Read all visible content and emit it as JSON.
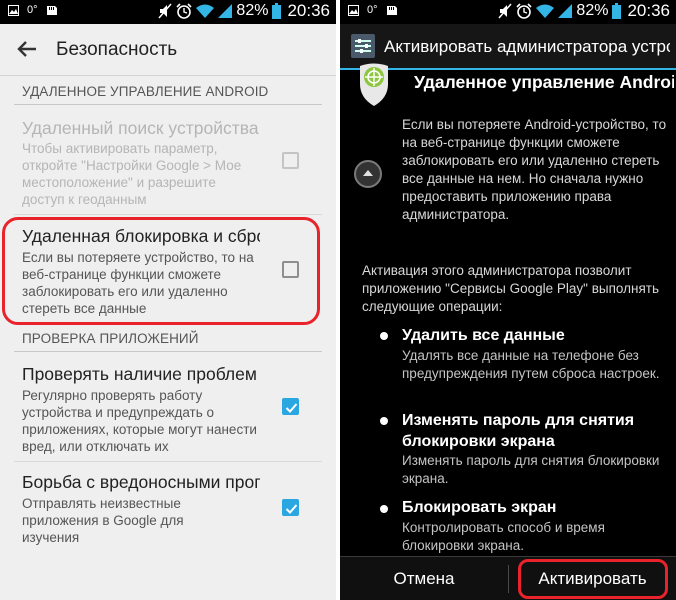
{
  "status_bar": {
    "left_label": "0°",
    "battery_pct": "82%",
    "time": "20:36"
  },
  "security_screen": {
    "title": "Безопасность",
    "section_android": "УДАЛЕННОЕ УПРАВЛЕНИЕ ANDROID",
    "remote_find": {
      "title": "Удаленный поиск устройства",
      "summary": "Чтобы активировать параметр, откройте \"Настройки Google > Мое местоположение\" и разрешите доступ к геоданным",
      "checked": false,
      "enabled": false
    },
    "remote_lock": {
      "title": "Удаленная блокировка и сброс",
      "summary": "Если вы потеряете устройство, то на веб-странице функции сможете заблокировать его или удаленно стереть все данные",
      "checked": false,
      "enabled": true
    },
    "section_apps": "ПРОВЕРКА ПРИЛОЖЕНИЙ",
    "verify_apps": {
      "title": "Проверять наличие проблем",
      "summary": "Регулярно проверять работу устройства и предупреждать о приложениях, которые могут нанести вред, или отключать их",
      "checked": true
    },
    "malware": {
      "title": "Борьба с вредоносными программами",
      "summary": "Отправлять неизвестные приложения в Google для изучения",
      "checked": true
    }
  },
  "admin_screen": {
    "title": "Активировать администратора устройства?",
    "app_name": "Удаленное управление Android",
    "description": "Если вы потеряете Android-устройство, то на веб-странице функции сможете заблокировать его или удаленно стереть все данные на нем. Но сначала нужно предоставить приложению права администратора.",
    "intro": "Активация этого администратора позволит приложению \"Сервисы Google Play\" выполнять следующие операции:",
    "policies": [
      {
        "title": "Удалить все данные",
        "desc": "Удалять все данные на телефоне без предупреждения путем сброса настроек."
      },
      {
        "title": "Изменять пароль для снятия блокировки экрана",
        "desc": "Изменять пароль для снятия блокировки экрана."
      },
      {
        "title": "Блокировать экран",
        "desc": "Контролировать способ и время блокировки экрана."
      }
    ],
    "cancel_label": "Отмена",
    "activate_label": "Активировать"
  },
  "colors": {
    "accent_blue": "#33b5e5",
    "checkbox_blue": "#2aa6e0",
    "highlight_red": "#e8232b",
    "dark_bg": "#000000",
    "light_bg": "#efefef"
  },
  "icons": [
    "gallery-icon",
    "sd-card-icon",
    "mute-icon",
    "alarm-icon",
    "wifi-icon",
    "signal-icon",
    "battery-icon",
    "back-arrow-icon",
    "settings-icon",
    "admin-app-icon",
    "collapse-icon"
  ]
}
